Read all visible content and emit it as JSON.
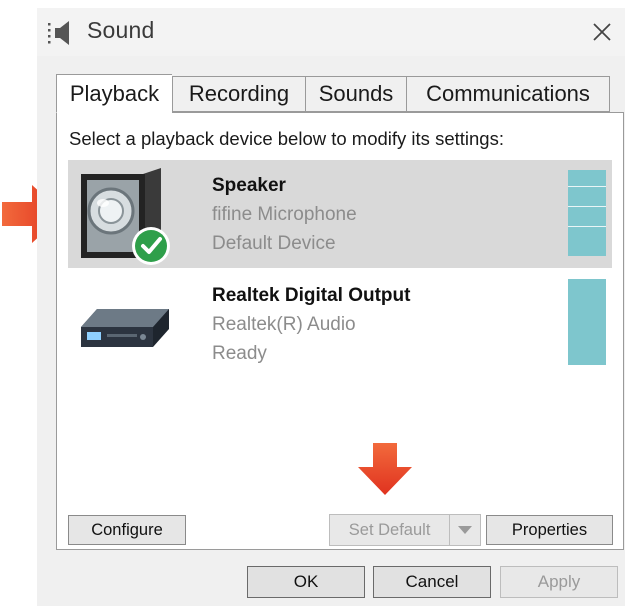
{
  "window": {
    "title": "Sound",
    "title_icon": "speaker-icon",
    "close_icon": "close-icon"
  },
  "tabs": [
    {
      "label": "Playback",
      "active": true
    },
    {
      "label": "Recording",
      "active": false
    },
    {
      "label": "Sounds",
      "active": false
    },
    {
      "label": "Communications",
      "active": false
    }
  ],
  "instruction": "Select a playback device below to modify its settings:",
  "devices": [
    {
      "name": "Speaker",
      "line1": "fifine Microphone",
      "line2": "Default Device",
      "icon": "speaker-device-icon",
      "badge_icon": "default-checkmark-icon",
      "selected": true
    },
    {
      "name": "Realtek Digital Output",
      "line1": "Realtek(R) Audio",
      "line2": "Ready",
      "icon": "digital-output-device-icon",
      "selected": false
    }
  ],
  "buttons": {
    "configure": "Configure",
    "set_default": "Set Default",
    "properties": "Properties",
    "ok": "OK",
    "cancel": "Cancel",
    "apply": "Apply"
  },
  "colors": {
    "annotation_arrow": "#e8432a",
    "level_meter": "#7ec6cd",
    "selection": "#d9d9d9",
    "badge": "#2e9f4a"
  }
}
